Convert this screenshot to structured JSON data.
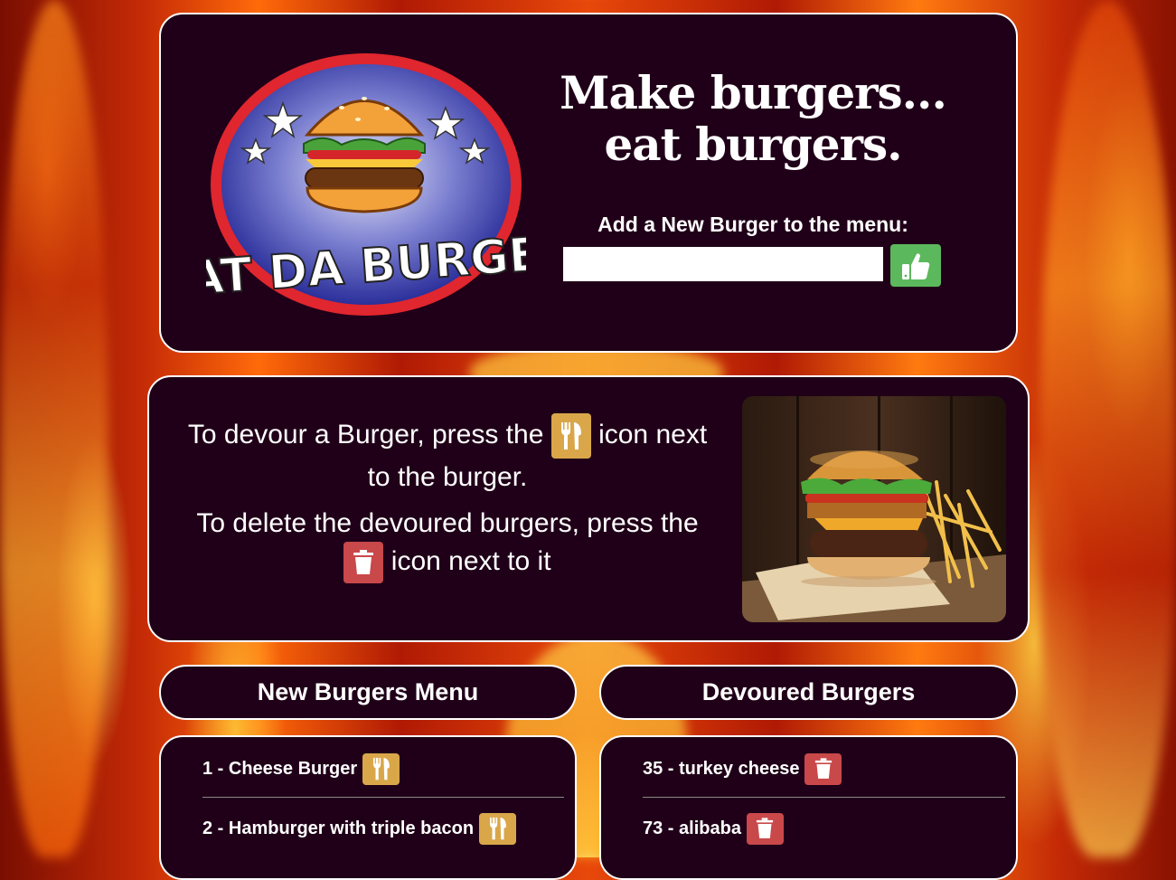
{
  "hero": {
    "logo_text": "EAT DA BURGER",
    "headline_line1": "Make burgers...",
    "headline_line2": "eat burgers.",
    "add_label": "Add a New Burger to the menu:",
    "input_value": "",
    "submit_icon": "thumbs-up-icon"
  },
  "info": {
    "devour_before": "To devour a Burger, press the",
    "devour_after": "icon next to the burger.",
    "devour_icon": "utensils-icon",
    "delete_before": "To delete the devoured burgers, press the",
    "delete_after": "icon next to it",
    "delete_icon": "trash-icon"
  },
  "new_menu": {
    "title": "New Burgers Menu",
    "items": [
      {
        "label": "1 - Cheese Burger"
      },
      {
        "label": "2 - Hamburger with triple bacon"
      }
    ]
  },
  "devoured": {
    "title": "Devoured Burgers",
    "items": [
      {
        "label": "35 - turkey cheese"
      },
      {
        "label": "73 - alibaba"
      }
    ]
  },
  "colors": {
    "panel_bg": "#200018",
    "success_green": "#5cb85c",
    "devour_gold": "#d9a74a",
    "delete_red": "#c9484a"
  }
}
